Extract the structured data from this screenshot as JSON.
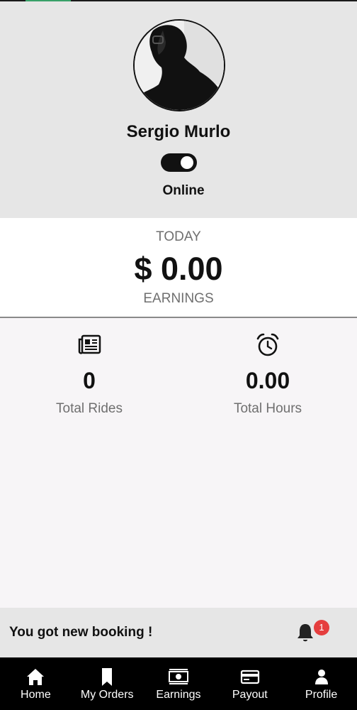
{
  "profile": {
    "name": "Sergio Murlo",
    "status": "Online",
    "online": true
  },
  "earnings": {
    "period": "TODAY",
    "amount": "$ 0.00",
    "label": "EARNINGS"
  },
  "stats": [
    {
      "icon": "newspaper-icon",
      "value": "0",
      "label": "Total Rides"
    },
    {
      "icon": "alarm-clock-icon",
      "value": "0.00",
      "label": "Total Hours"
    }
  ],
  "notification": {
    "message": "You got new booking !",
    "count": "1"
  },
  "tabs": [
    {
      "icon": "home-icon",
      "label": "Home"
    },
    {
      "icon": "bookmark-icon",
      "label": "My Orders"
    },
    {
      "icon": "cash-icon",
      "label": "Earnings"
    },
    {
      "icon": "credit-card-icon",
      "label": "Payout"
    },
    {
      "icon": "person-icon",
      "label": "Profile"
    }
  ],
  "colors": {
    "header_bg": "#e6e6e6",
    "tabbar_bg": "#000000",
    "badge": "#e53e3e",
    "accent": "#38a169"
  }
}
